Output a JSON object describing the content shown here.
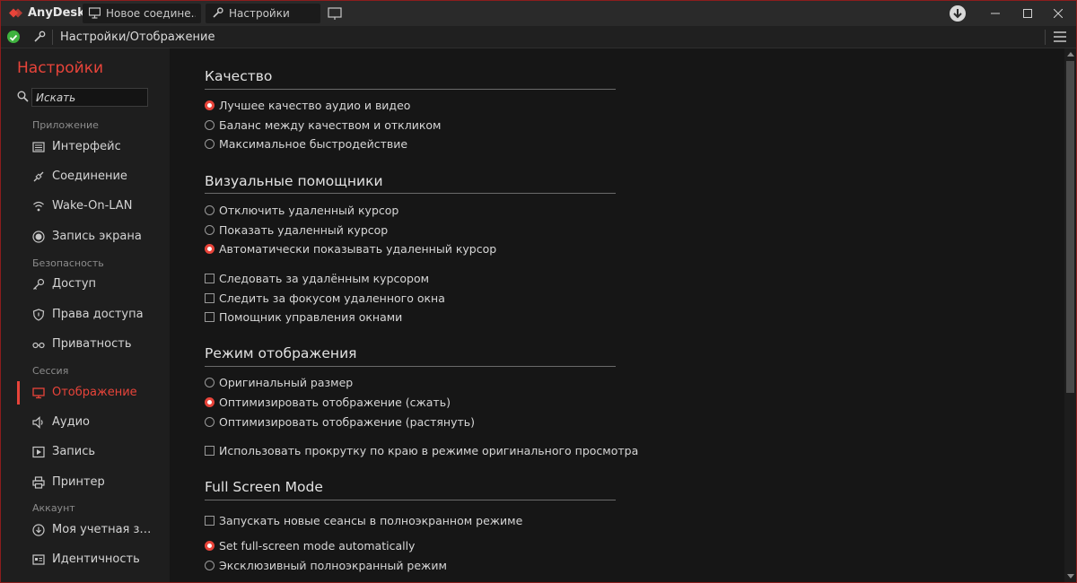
{
  "app": {
    "name": "AnyDesk",
    "brand_color": "#e8443a"
  },
  "tabs": [
    {
      "label": "Новое соедине...",
      "icon": "monitor-icon"
    },
    {
      "label": "Настройки",
      "icon": "wrench-icon"
    }
  ],
  "address": {
    "path": "Настройки/Отображение",
    "status_color": "#3fb23f"
  },
  "sidebar": {
    "title": "Настройки",
    "search_placeholder": "Искать",
    "sections": [
      {
        "label": "Приложение",
        "items": [
          {
            "label": "Интерфейс",
            "icon": "interface-icon"
          },
          {
            "label": "Соединение",
            "icon": "connection-icon"
          },
          {
            "label": "Wake-On-LAN",
            "icon": "wifi-icon"
          },
          {
            "label": "Запись экрана",
            "icon": "record-dot-icon"
          }
        ]
      },
      {
        "label": "Безопасность",
        "items": [
          {
            "label": "Доступ",
            "icon": "key-icon"
          },
          {
            "label": "Права доступа",
            "icon": "shield-icon"
          },
          {
            "label": "Приватность",
            "icon": "glasses-icon"
          }
        ]
      },
      {
        "label": "Сессия",
        "items": [
          {
            "label": "Отображение",
            "icon": "monitor-icon",
            "active": true
          },
          {
            "label": "Аудио",
            "icon": "speaker-icon"
          },
          {
            "label": "Запись",
            "icon": "play-icon"
          },
          {
            "label": "Принтер",
            "icon": "printer-icon"
          }
        ]
      },
      {
        "label": "Аккаунт",
        "items": [
          {
            "label": "Моя учетная запи...",
            "icon": "download-circle-icon"
          },
          {
            "label": "Идентичность",
            "icon": "id-card-icon"
          }
        ]
      }
    ]
  },
  "groups": [
    {
      "title": "Качество",
      "options": [
        {
          "type": "radio",
          "label": "Лучшее качество аудио и видео",
          "checked": true
        },
        {
          "type": "radio",
          "label": "Баланс между качеством и откликом",
          "checked": false
        },
        {
          "type": "radio",
          "label": "Максимальное быстродействие",
          "checked": false
        }
      ]
    },
    {
      "title": "Визуальные помощники",
      "options": [
        {
          "type": "radio",
          "label": "Отключить удаленный курсор",
          "checked": false
        },
        {
          "type": "radio",
          "label": "Показать удаленный курсор",
          "checked": false
        },
        {
          "type": "radio",
          "label": "Автоматически показывать удаленный курсор",
          "checked": true
        },
        {
          "type": "checkbox",
          "label": "Следовать за удалённым курсором",
          "checked": false
        },
        {
          "type": "checkbox",
          "label": "Следить за фокусом удаленного окна",
          "checked": false
        },
        {
          "type": "checkbox",
          "label": "Помощник управления окнами",
          "checked": false
        }
      ]
    },
    {
      "title": "Режим отображения",
      "options": [
        {
          "type": "radio",
          "label": "Оригинальный размер",
          "checked": false
        },
        {
          "type": "radio",
          "label": "Оптимизировать отображение (сжать)",
          "checked": true
        },
        {
          "type": "radio",
          "label": "Оптимизировать отображение (растянуть)",
          "checked": false
        },
        {
          "type": "checkbox",
          "label": "Использовать прокрутку по краю в режиме оригинального просмотра",
          "checked": false
        }
      ]
    },
    {
      "title": "Full Screen Mode",
      "options": [
        {
          "type": "checkbox",
          "label": "Запускать новые сеансы в полноэкранном режиме",
          "checked": false
        },
        {
          "type": "radio",
          "label": "Set full-screen mode automatically",
          "checked": true
        },
        {
          "type": "radio",
          "label": "Эксклюзивный полноэкранный режим",
          "checked": false
        }
      ]
    }
  ]
}
